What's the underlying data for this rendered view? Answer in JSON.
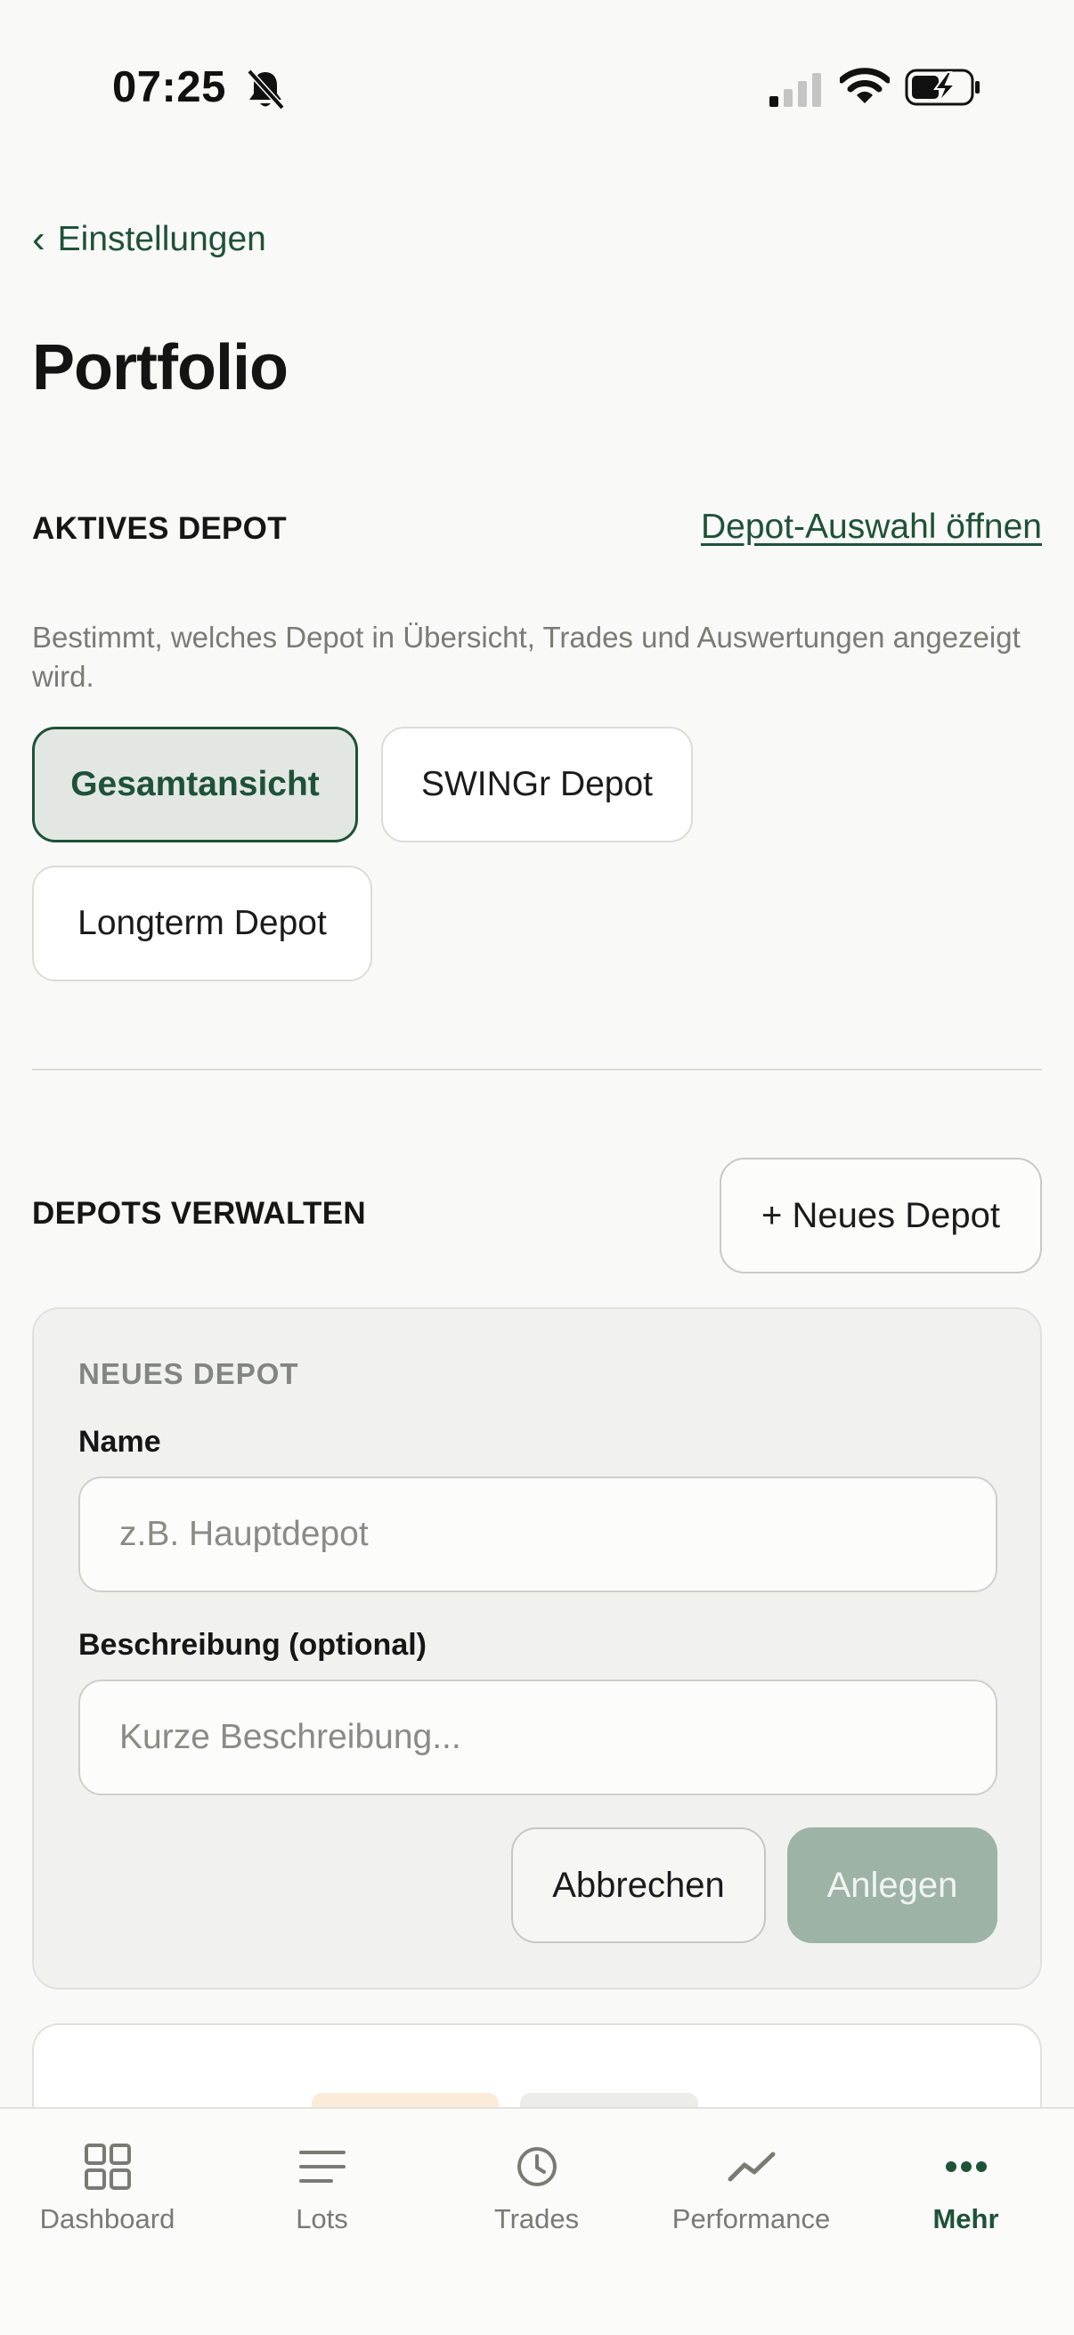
{
  "status_bar": {
    "time": "07:25"
  },
  "header": {
    "back_label": "Einstellungen",
    "title": "Portfolio"
  },
  "active_depot": {
    "section_label": "AKTIVES DEPOT",
    "open_picker_link": "Depot-Auswahl öffnen",
    "helper_text": "Bestimmt, welches Depot in Übersicht, Trades und Auswertungen angezeigt wird.",
    "options": [
      {
        "label": "Gesamtansicht",
        "selected": true
      },
      {
        "label": "SWINGr Depot",
        "selected": false
      },
      {
        "label": "Longterm Depot",
        "selected": false
      }
    ]
  },
  "manage": {
    "section_label": "DEPOTS VERWALTEN",
    "new_button": "+ Neues Depot",
    "form": {
      "title": "NEUES DEPOT",
      "name_label": "Name",
      "name_placeholder": "z.B. Hauptdepot",
      "name_value": "",
      "description_label": "Beschreibung (optional)",
      "description_placeholder": "Kurze Beschreibung...",
      "description_value": "",
      "cancel_button": "Abbrechen",
      "submit_button": "Anlegen"
    }
  },
  "tab_bar": {
    "items": [
      {
        "label": "Dashboard",
        "icon": "grid-icon",
        "active": false
      },
      {
        "label": "Lots",
        "icon": "list-icon",
        "active": false
      },
      {
        "label": "Trades",
        "icon": "clock-icon",
        "active": false
      },
      {
        "label": "Performance",
        "icon": "trend-icon",
        "active": false
      },
      {
        "label": "Mehr",
        "icon": "more-icon",
        "active": true
      }
    ]
  },
  "colors": {
    "accent": "#1e5238",
    "background": "#f9f9f7",
    "chip_selected_bg": "#e3e7e2",
    "primary_disabled": "#9db3a5"
  }
}
